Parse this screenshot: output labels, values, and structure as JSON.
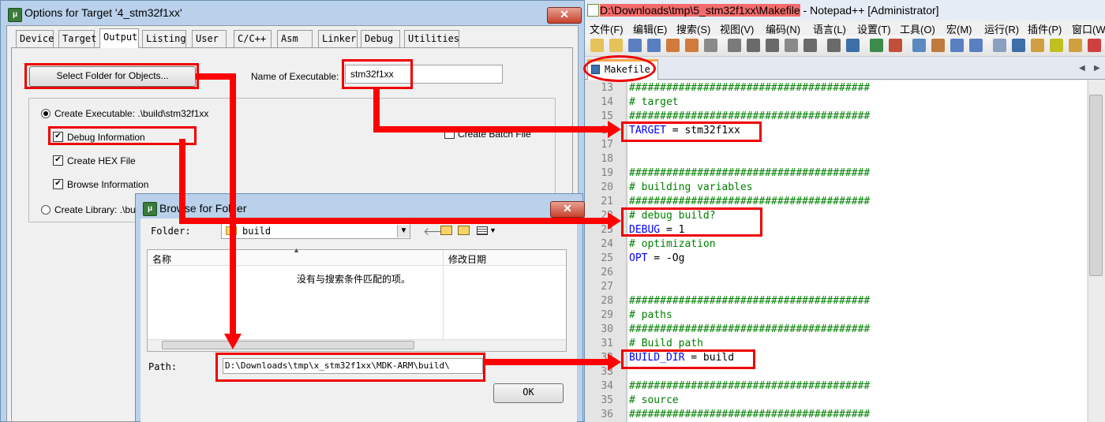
{
  "options_dialog": {
    "title": "Options for Target '4_stm32f1xx'",
    "close_label": "✕",
    "tabs": [
      "Device",
      "Target",
      "Output",
      "Listing",
      "User",
      "C/C++",
      "Asm",
      "Linker",
      "Debug",
      "Utilities"
    ],
    "selected_tab": "Output",
    "select_folder_label": "Select Folder for Objects...",
    "name_of_executable_label": "Name of Executable:",
    "name_of_executable_value": "stm32f1xx",
    "create_executable_label": "Create Executable:  .\\build\\stm32f1xx",
    "debug_info_label": "Debug Information",
    "create_hex_label": "Create HEX File",
    "browse_info_label": "Browse Information",
    "create_library_label": "Create Library:  .\\bu",
    "create_batch_label": "Create Batch File"
  },
  "browse_dialog": {
    "title": "Browse for Folder",
    "close_label": "✕",
    "folder_label": "Folder:",
    "folder_value": "build",
    "col_name": "名称",
    "col_modified": "修改日期",
    "empty_message": "没有与搜索条件匹配的项。",
    "path_label": "Path:",
    "path_value": "D:\\Downloads\\tmp\\x_stm32f1xx\\MDK-ARM\\build\\",
    "ok_label": "OK"
  },
  "notepad": {
    "title_path": "D:\\Downloads\\tmp\\5_stm32f1xx\\Makefile",
    "title_rest": " - Notepad++ [Administrator]",
    "menu": [
      "文件(F)",
      "编辑(E)",
      "搜索(S)",
      "视图(V)",
      "编码(N)",
      "语言(L)",
      "设置(T)",
      "工具(O)",
      "宏(M)",
      "运行(R)",
      "插件(P)",
      "窗口(W"
    ],
    "tab_label": "Makefile",
    "lines": [
      {
        "n": "13",
        "text": "#######################################",
        "cls": "cm"
      },
      {
        "n": "14",
        "text": "# target",
        "cls": "cm"
      },
      {
        "n": "15",
        "text": "#######################################",
        "cls": "cm"
      },
      {
        "n": "16",
        "kw": "TARGET",
        "rest": " = stm32f1xx"
      },
      {
        "n": "17",
        "text": ""
      },
      {
        "n": "18",
        "text": ""
      },
      {
        "n": "19",
        "text": "#######################################",
        "cls": "cm"
      },
      {
        "n": "20",
        "text": "# building variables",
        "cls": "cm"
      },
      {
        "n": "21",
        "text": "#######################################",
        "cls": "cm"
      },
      {
        "n": "22",
        "text": "# debug build?",
        "cls": "cm"
      },
      {
        "n": "23",
        "kw": "DEBUG",
        "rest": " = 1"
      },
      {
        "n": "24",
        "text": "# optimization",
        "cls": "cm"
      },
      {
        "n": "25",
        "kw": "OPT",
        "rest": " = -Og"
      },
      {
        "n": "26",
        "text": ""
      },
      {
        "n": "27",
        "text": ""
      },
      {
        "n": "28",
        "text": "#######################################",
        "cls": "cm"
      },
      {
        "n": "29",
        "text": "# paths",
        "cls": "cm"
      },
      {
        "n": "30",
        "text": "#######################################",
        "cls": "cm"
      },
      {
        "n": "31",
        "text": "# Build path",
        "cls": "cm"
      },
      {
        "n": "32",
        "kw": "BUILD_DIR",
        "rest": " = build"
      },
      {
        "n": "33",
        "text": ""
      },
      {
        "n": "34",
        "text": "#######################################",
        "cls": "cm"
      },
      {
        "n": "35",
        "text": "# source",
        "cls": "cm"
      },
      {
        "n": "36",
        "text": "#######################################",
        "cls": "cm"
      }
    ]
  },
  "colors": {
    "annotation_red": "#ff0000",
    "comment_green": "#008000",
    "keyword_blue": "#0000ff",
    "title_highlight": "#f36b6b"
  }
}
